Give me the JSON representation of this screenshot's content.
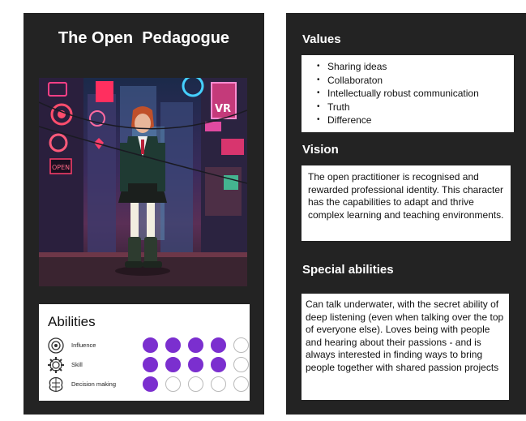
{
  "left_card": {
    "title": "The Open  Pedagogue",
    "portrait": {
      "alt": "Illustrated character standing in a neon-lit city street",
      "signs": [
        "OPEN",
        "VR"
      ]
    },
    "abilities": {
      "heading": "Abilities",
      "rows": [
        {
          "label": "Influence",
          "icon": "influence-icon",
          "filled": 4,
          "total": 5
        },
        {
          "label": "Skill",
          "icon": "skill-gear-icon",
          "filled": 4,
          "total": 5
        },
        {
          "label": "Decision making",
          "icon": "decision-brain-icon",
          "filled": 1,
          "total": 5
        }
      ],
      "dot_color": "#7b2fcf"
    }
  },
  "right_card": {
    "values": {
      "heading": "Values",
      "items": [
        "Sharing ideas",
        "Collaboraton",
        "Intellectually robust communication",
        "Truth",
        "Difference"
      ]
    },
    "vision": {
      "heading": "Vision",
      "text": "The open practitioner is recognised and rewarded professional identity. This character has the capabilities to adapt and thrive complex learning and teaching environments."
    },
    "special_abilities": {
      "heading": "Special abilities",
      "text": "Can talk underwater, with the secret ability of deep listening (even when talking over the top of everyone else). Loves being with people and hearing about their passions - and is always interested in finding ways to bring people together with shared passion projects"
    }
  },
  "colors": {
    "card_bg": "#232323",
    "accent": "#7b2fcf"
  }
}
